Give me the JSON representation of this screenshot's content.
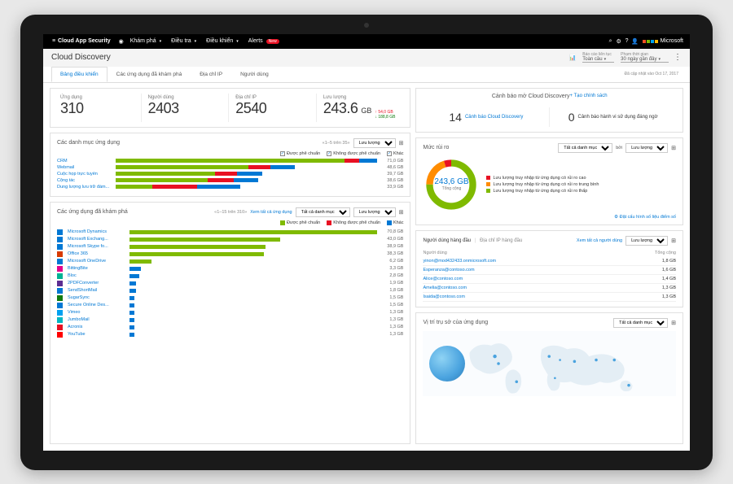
{
  "topbar": {
    "brand": "Cloud App Security",
    "nav": [
      "Khám phá",
      "Điều tra",
      "Điều khiển",
      "Alerts"
    ],
    "new_badge": "New",
    "ms": "Microsoft"
  },
  "subheader": {
    "title": "Cloud Discovery",
    "report_lbl": "Báo cáo liên tục",
    "report_val": "Toàn cầu",
    "range_lbl": "Phạm thời gian",
    "range_val": "30 ngày gần đây"
  },
  "tabs": [
    "Bảng điều khiển",
    "Các ứng dụng đã khám phá",
    "Địa chỉ IP",
    "Người dùng"
  ],
  "updated": "Đã cập nhật vào Oct 17, 2017",
  "stats": {
    "apps_lbl": "Ứng dụng",
    "apps": "310",
    "users_lbl": "Người dùng",
    "users": "2403",
    "ips_lbl": "Địa chỉ IP",
    "ips": "2540",
    "traffic_lbl": "Lưu lượng",
    "traffic": "243.6",
    "traffic_unit": "GB",
    "up": "54,0 GB",
    "down": "188,8 GB"
  },
  "categories": {
    "title": "Các danh mục ứng dụng",
    "pager": "«1–5 trên 35»",
    "by": "Lưu lượng",
    "legend": [
      "Được phê chuẩn",
      "Không được phê chuẩn",
      "Khác"
    ]
  },
  "apps": {
    "title": "Các ứng dụng đã khám phá",
    "pager": "«1–15 trên 310»",
    "link": "Xem tất cả ứng dụng",
    "filter1": "Tất cả danh mục",
    "by": "Lưu lượng",
    "legend": [
      "Được phê chuẩn",
      "Không được phê chuẩn",
      "Khác"
    ]
  },
  "alerts": {
    "title": "Cảnh báo mở Cloud Discovery",
    "create": "+ Tạo chính sách",
    "count": "14",
    "a1": "Cảnh báo Cloud Discovery",
    "count2": "0",
    "a2": "Cảnh báo hành vi sử dụng đáng ngờ"
  },
  "risk": {
    "title": "Mức rủi ro",
    "filter": "Tất cả danh mục",
    "by_lbl": "bởi",
    "by": "Lưu lượng",
    "center_val": "243,6 GB",
    "center_lbl": "Tổng cộng",
    "items": [
      "Lưu lượng truy nhập từ ứng dụng có rủi ro cao",
      "Lưu lượng truy nhập từ ứng dụng có rủi ro trung bình",
      "Lưu lượng truy nhập từ ứng dụng có rủi ro thấp"
    ],
    "footer": "Đặt cấu hình số liệu điểm số"
  },
  "topusers": {
    "tabs": [
      "Người dùng hàng đầu",
      "Địa chỉ IP hàng đầu"
    ],
    "link": "Xem tất cả người dùng",
    "by": "Lưu lượng",
    "col1": "Người dùng",
    "col2": "Tổng cộng",
    "rows": [
      {
        "u": "yinon@mod432433.onmicrosoft.com",
        "v": "1,8 GB"
      },
      {
        "u": "Esperanza@contoso.com",
        "v": "1,6 GB"
      },
      {
        "u": "Alice@contoso.com",
        "v": "1,4 GB"
      },
      {
        "u": "Amelia@contoso.com",
        "v": "1,3 GB"
      },
      {
        "u": "Isaida@contoso.com",
        "v": "1,3 GB"
      }
    ]
  },
  "maps": {
    "title": "Vị trí trụ sở của ứng dụng",
    "filter": "Tất cả danh mục"
  },
  "chart_data": [
    {
      "type": "bar",
      "title": "Các danh mục ứng dụng",
      "ylabel": "Lưu lượng (GB)",
      "categories": [
        "CRM",
        "Webmail",
        "Cuộc họp trực tuyến",
        "Cộng tác",
        "Dung lượng lưu trữ đám..."
      ],
      "series": [
        {
          "name": "Được phê chuẩn",
          "color": "#7fba00",
          "values": [
            62,
            36,
            27,
            25,
            10
          ]
        },
        {
          "name": "Không được phê chuẩn",
          "color": "#e81123",
          "values": [
            4,
            6,
            6,
            7,
            12
          ]
        },
        {
          "name": "Khác",
          "color": "#0078d4",
          "values": [
            5,
            6.6,
            6.7,
            6.6,
            11.9
          ]
        }
      ],
      "totals": [
        "71,0 GB",
        "48,6 GB",
        "39,7 GB",
        "38,6 GB",
        "33,9 GB"
      ]
    },
    {
      "type": "bar",
      "title": "Các ứng dụng đã khám phá",
      "ylabel": "Lưu lượng (GB)",
      "categories": [
        "Microsoft Dynamics",
        "Microsoft Exchang...",
        "Microsoft Skype fo...",
        "Office 365",
        "Microsoft OneDrive",
        "BittingBite",
        "Bloc",
        "2PDFConverter",
        "SendShortMail",
        "SugarSync",
        "Secure Online Des...",
        "Vimeo",
        "JumboMail",
        "Acronis",
        "YouTube"
      ],
      "series": [
        {
          "name": "Được phê chuẩn",
          "color": "#7fba00",
          "values": [
            70.8,
            43.0,
            38.9,
            38.3,
            6.2,
            0,
            0,
            0,
            0,
            0,
            0,
            0,
            0,
            0,
            0
          ]
        },
        {
          "name": "Không được phê chuẩn",
          "color": "#e81123",
          "values": [
            0,
            0,
            0,
            0,
            0,
            0,
            0,
            0,
            0,
            0,
            0,
            0,
            0,
            0,
            0
          ]
        },
        {
          "name": "Khác",
          "color": "#0078d4",
          "values": [
            0,
            0,
            0,
            0,
            0,
            3.3,
            2.8,
            1.9,
            1.8,
            1.5,
            1.5,
            1.3,
            1.3,
            1.3,
            1.3
          ]
        }
      ],
      "totals": [
        "70,8 GB",
        "43,0 GB",
        "38,9 GB",
        "38,3 GB",
        "6,2 GB",
        "3,3 GB",
        "2,8 GB",
        "1,9 GB",
        "1,8 GB",
        "1,5 GB",
        "1,5 GB",
        "1,3 GB",
        "1,3 GB",
        "1,3 GB",
        "1,3 GB"
      ],
      "icons": [
        "#0078d4",
        "#0078d4",
        "#0078d4",
        "#d83b01",
        "#0078d4",
        "#e3008c",
        "#00b294",
        "#5c2d91",
        "#0078d4",
        "#107c10",
        "#0078d4",
        "#00a1f1",
        "#00b7c3",
        "#e81123",
        "#ff0000"
      ]
    },
    {
      "type": "pie",
      "title": "Mức rủi ro",
      "total": "243,6 GB",
      "series": [
        {
          "name": "Rủi ro cao",
          "color": "#e81123",
          "value": 5
        },
        {
          "name": "Rủi ro trung bình",
          "color": "#ff8c00",
          "value": 20
        },
        {
          "name": "Rủi ro thấp",
          "color": "#7fba00",
          "value": 75
        }
      ]
    }
  ]
}
